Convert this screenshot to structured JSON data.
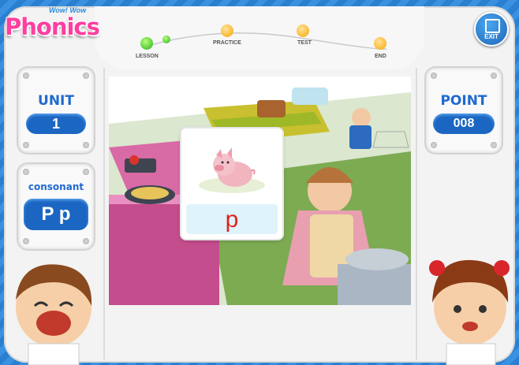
{
  "app": {
    "logo_text": "Phonics",
    "logo_small": "Wow! Wow"
  },
  "exit": {
    "label": "EXIT"
  },
  "steps": [
    {
      "label": "LESSON",
      "status": "done"
    },
    {
      "label": "PRACTICE",
      "status": "todo"
    },
    {
      "label": "TEST",
      "status": "todo"
    },
    {
      "label": "END",
      "status": "todo"
    }
  ],
  "unit": {
    "label": "UNIT",
    "value": "1"
  },
  "category": {
    "label": "consonant",
    "value": "P p"
  },
  "point": {
    "label": "POINT",
    "value": "008"
  },
  "card": {
    "letter": "p",
    "picture": "pig-icon"
  },
  "colors": {
    "accent_blue": "#1b66c2",
    "logo_pink": "#ff3ea0",
    "letter_red": "#e0231e",
    "answer_bg": "#dff3fa",
    "progress_green": "#27b01a",
    "progress_orange": "#f6a700"
  }
}
